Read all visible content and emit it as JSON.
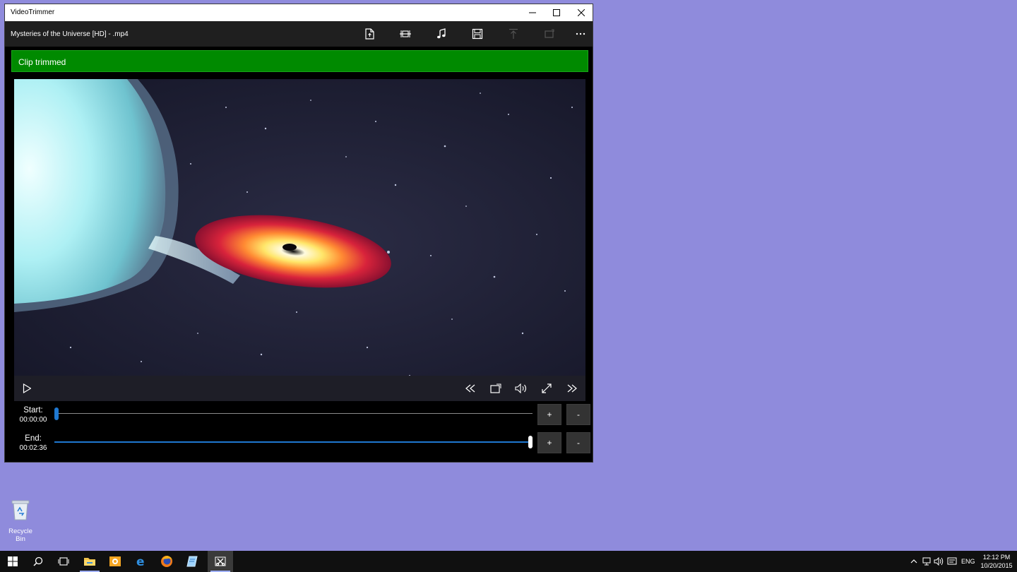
{
  "window": {
    "title": "VideoTrimmer",
    "file_title": "Mysteries of the Universe [HD] - .mp4"
  },
  "banner": {
    "message": "Clip trimmed",
    "color": "#008a00"
  },
  "toolbar_icons": [
    "open-file-icon",
    "trim-icon",
    "music-icon",
    "save-icon",
    "upload-icon",
    "rotate-icon",
    "more-icon"
  ],
  "player": {
    "controls": [
      "play-icon",
      "rewind-icon",
      "aspect-ratio-icon",
      "volume-icon",
      "fullscreen-icon",
      "fast-forward-icon"
    ]
  },
  "trim": {
    "start": {
      "label": "Start:",
      "time": "00:00:00",
      "position": 0
    },
    "end": {
      "label": "End:",
      "time": "00:02:36",
      "position": 1
    },
    "plus_label": "+",
    "minus_label": "-",
    "accent_color": "#1f78d1"
  },
  "desktop": {
    "recycle_bin_label": "Recycle Bin"
  },
  "taskbar": {
    "apps": [
      "start-icon",
      "search-icon",
      "task-view-icon",
      "file-explorer-icon",
      "outlook-icon",
      "edge-icon",
      "firefox-icon",
      "notepad-icon",
      "videotrimmer-icon"
    ],
    "language": "ENG",
    "time": "12:12 PM",
    "date": "10/20/2015"
  }
}
